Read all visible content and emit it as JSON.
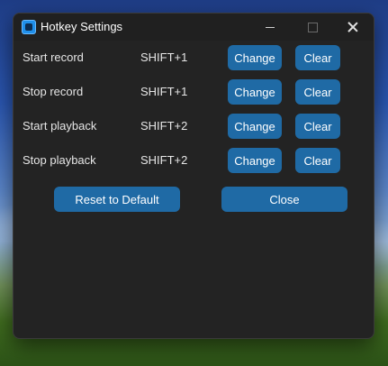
{
  "window": {
    "title": "Hotkey Settings"
  },
  "hotkeys": [
    {
      "action": "Start record",
      "key": "SHIFT+1",
      "change_label": "Change",
      "clear_label": "Clear"
    },
    {
      "action": "Stop record",
      "key": "SHIFT+1",
      "change_label": "Change",
      "clear_label": "Clear"
    },
    {
      "action": "Start playback",
      "key": "SHIFT+2",
      "change_label": "Change",
      "clear_label": "Clear"
    },
    {
      "action": "Stop playback",
      "key": "SHIFT+2",
      "change_label": "Change",
      "clear_label": "Clear"
    }
  ],
  "footer": {
    "reset_label": "Reset to Default",
    "close_label": "Close"
  },
  "icons": {
    "app": "app-icon",
    "minimize": "minimize-icon",
    "maximize": "maximize-icon",
    "close": "close-icon"
  },
  "colors": {
    "accent": "#1f6aa5",
    "window_bg": "#232323",
    "text": "#e6e6e6"
  }
}
